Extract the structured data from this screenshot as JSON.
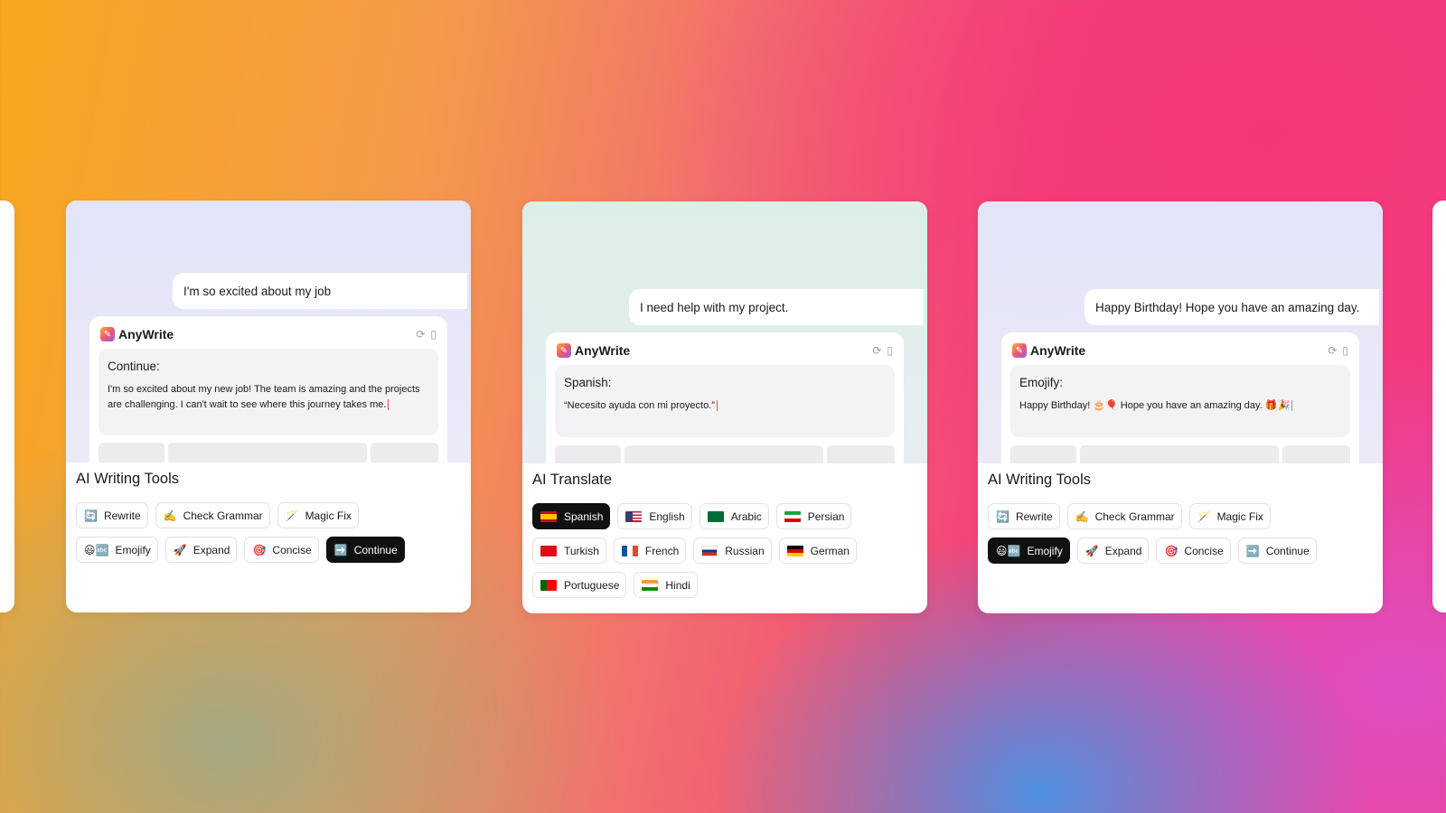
{
  "brand": {
    "name": "AnyWrite"
  },
  "cards": [
    {
      "id": "writing-continue",
      "bubble": "I'm so excited about my job",
      "output_title": "Continue:",
      "output_text": "I'm so excited about my new job! The team is amazing and the projects are challenging. I can't wait to see where this journey takes me.",
      "section_title": "AI Writing Tools",
      "rows": [
        [
          {
            "label": "Rewrite",
            "icon": "refresh-icon"
          },
          {
            "label": "Check Grammar",
            "icon": "writing-hand-icon"
          },
          {
            "label": "Magic Fix",
            "icon": "magic-wand-icon"
          }
        ],
        [
          {
            "label": "Emojify",
            "icon": "smiley-icon"
          },
          {
            "label": "Expand",
            "icon": "rocket-icon"
          },
          {
            "label": "Concise",
            "icon": "target-icon"
          },
          {
            "label": "Continue",
            "icon": "arrow-right-icon",
            "active": true
          }
        ]
      ]
    },
    {
      "id": "translate",
      "bubble": "I need help with my project.",
      "output_title": "Spanish:",
      "output_text": "“Necesito ayuda con mi proyecto.”",
      "section_title": "AI Translate",
      "rows": [
        [
          {
            "label": "Spanish",
            "flag": "spain",
            "active": true
          },
          {
            "label": "English",
            "flag": "usa"
          },
          {
            "label": "Arabic",
            "flag": "saudi"
          },
          {
            "label": "Persian",
            "flag": "iran"
          }
        ],
        [
          {
            "label": "Turkish",
            "flag": "turkey"
          },
          {
            "label": "French",
            "flag": "france"
          },
          {
            "label": "Russian",
            "flag": "russia"
          },
          {
            "label": "German",
            "flag": "germany"
          }
        ],
        [
          {
            "label": "Portuguese",
            "flag": "portugal"
          },
          {
            "label": "Hindi",
            "flag": "india"
          }
        ]
      ]
    },
    {
      "id": "writing-emojify",
      "bubble": "Happy Birthday! Hope you have an amazing day.",
      "output_title": "Emojify:",
      "output_text_parts": [
        "Happy Birthday!",
        "Hope you have an amazing day."
      ],
      "section_title": "AI Writing Tools",
      "rows": [
        [
          {
            "label": "Rewrite",
            "icon": "refresh-icon"
          },
          {
            "label": "Check Grammar",
            "icon": "writing-hand-icon"
          },
          {
            "label": "Magic Fix",
            "icon": "magic-wand-icon"
          }
        ],
        [
          {
            "label": "Emojify",
            "icon": "smiley-icon",
            "active": true
          },
          {
            "label": "Expand",
            "icon": "rocket-icon"
          },
          {
            "label": "Concise",
            "icon": "target-icon"
          },
          {
            "label": "Continue",
            "icon": "arrow-right-icon"
          }
        ]
      ]
    }
  ],
  "colors": {
    "active_chip": "#111111",
    "accent_orange": "#f7a81e",
    "accent_pink": "#f43e7a",
    "accent_blue": "#4696e6"
  }
}
